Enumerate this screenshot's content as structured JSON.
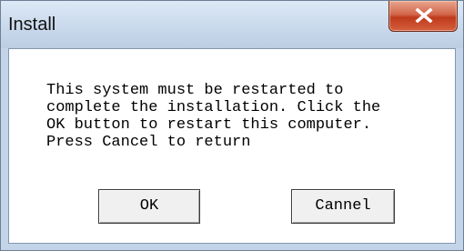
{
  "window": {
    "title": "Install",
    "close_symbol": "X"
  },
  "dialog": {
    "message": "This system must be restarted to\ncomplete the installation. Click the\nOK button to restart this computer.\nPress Cancel to return"
  },
  "buttons": {
    "ok_label": "OK",
    "cancel_label": "Cannel"
  },
  "icons": {
    "close": "close-icon"
  },
  "colors": {
    "titlebar": "#cddcee",
    "close_button": "#c9482a",
    "client_background": "#ffffff"
  }
}
